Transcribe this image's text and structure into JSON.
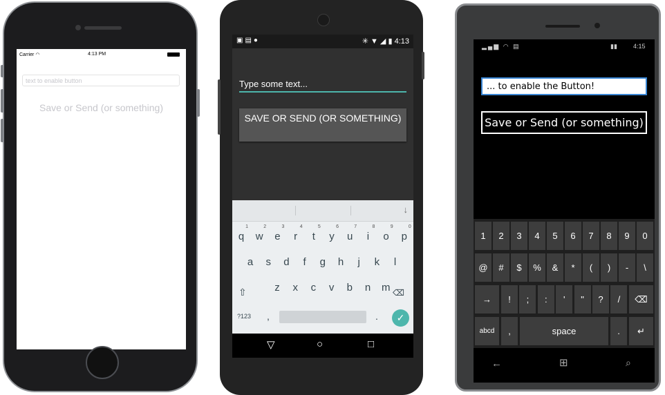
{
  "ios": {
    "carrier": "Carrier",
    "time": "4:13 PM",
    "entry_placeholder": "text to enable button",
    "button_label": "Save or Send (or something)"
  },
  "android": {
    "status_time": "4:13",
    "entry_text": "Type some text...",
    "button_label": "SAVE OR SEND (OR SOMETHING)",
    "keyboard": {
      "row1": [
        "q",
        "w",
        "e",
        "r",
        "t",
        "y",
        "u",
        "i",
        "o",
        "p"
      ],
      "row1_hints": [
        "1",
        "2",
        "3",
        "4",
        "5",
        "6",
        "7",
        "8",
        "9",
        "0"
      ],
      "row2": [
        "a",
        "s",
        "d",
        "f",
        "g",
        "h",
        "j",
        "k",
        "l"
      ],
      "row3": [
        "z",
        "x",
        "c",
        "v",
        "b",
        "n",
        "m"
      ],
      "symbols_key": "?123",
      "comma_key": ",",
      "period_key": "."
    }
  },
  "windows": {
    "status_time": "4:15",
    "entry_text": "... to enable the Button!",
    "button_label": "Save or Send (or something)",
    "keyboard": {
      "row1": [
        "1",
        "2",
        "3",
        "4",
        "5",
        "6",
        "7",
        "8",
        "9",
        "0"
      ],
      "row2": [
        "@",
        "#",
        "$",
        "%",
        "&",
        "*",
        "(",
        ")",
        "-",
        "\\"
      ],
      "row3": [
        "!",
        ";",
        ":",
        "'",
        "\"",
        "?",
        "/"
      ],
      "abcd_key": "abcd",
      "comma_key": ",",
      "space_key": "space",
      "period_key": "."
    }
  },
  "colors": {
    "android_accent": "#4db6ac",
    "windows_accent": "#3a86d4",
    "ios_placeholder": "#c7c7cc"
  }
}
